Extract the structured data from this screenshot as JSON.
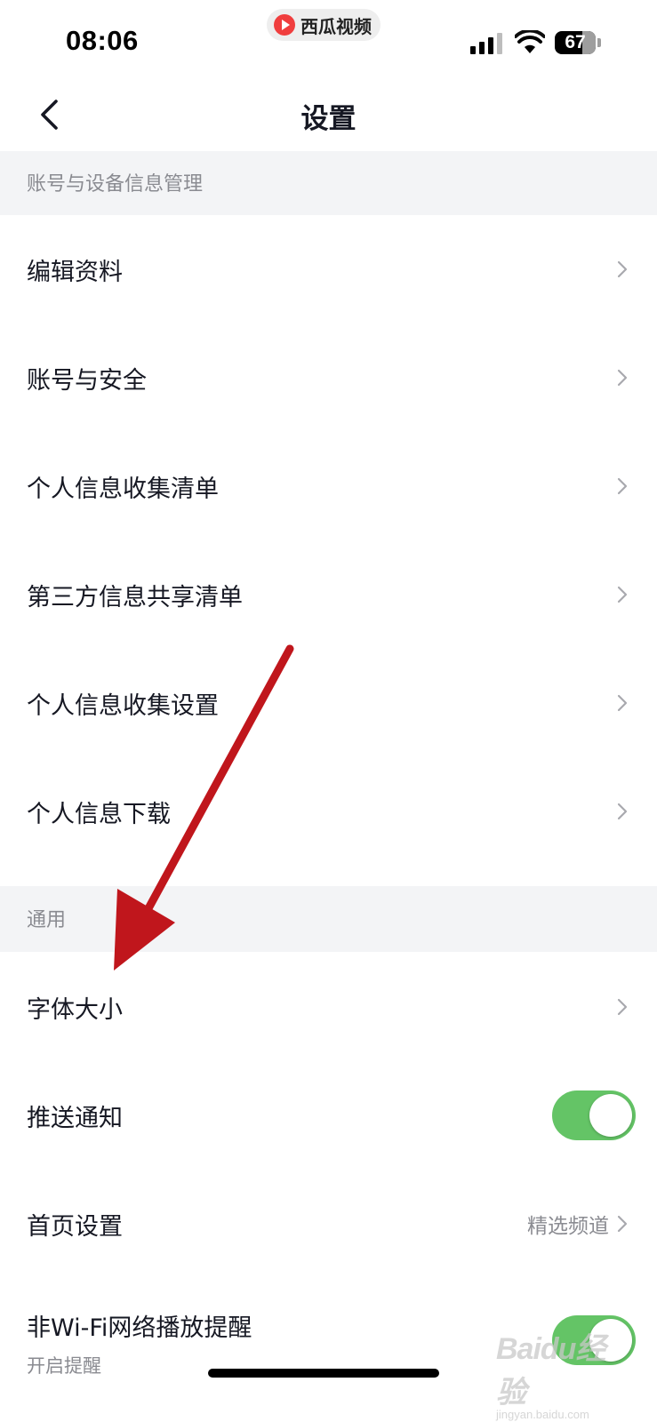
{
  "status_bar": {
    "time": "08:06",
    "app_name": "西瓜视频",
    "battery_level": "67",
    "battery_percent": 0.67,
    "signal_bars_active": 3
  },
  "nav": {
    "title": "设置"
  },
  "sections": {
    "account": {
      "header": "账号与设备信息管理",
      "items": [
        {
          "label": "编辑资料"
        },
        {
          "label": "账号与安全"
        },
        {
          "label": "个人信息收集清单"
        },
        {
          "label": "第三方信息共享清单"
        },
        {
          "label": "个人信息收集设置"
        },
        {
          "label": "个人信息下载"
        }
      ]
    },
    "general": {
      "header": "通用",
      "font_size": {
        "label": "字体大小"
      },
      "push": {
        "label": "推送通知",
        "enabled": true
      },
      "home": {
        "label": "首页设置",
        "value": "精选频道"
      },
      "wifi": {
        "label": "非Wi-Fi网络播放提醒",
        "sub": "开启提醒",
        "enabled": true
      }
    }
  },
  "colors": {
    "toggle_on": "#64c466",
    "section_bg": "#f3f4f6",
    "annotation_arrow": "#c0161c"
  },
  "watermark": {
    "brand": "Baidu经验",
    "sub": "jingyan.baidu.com"
  }
}
